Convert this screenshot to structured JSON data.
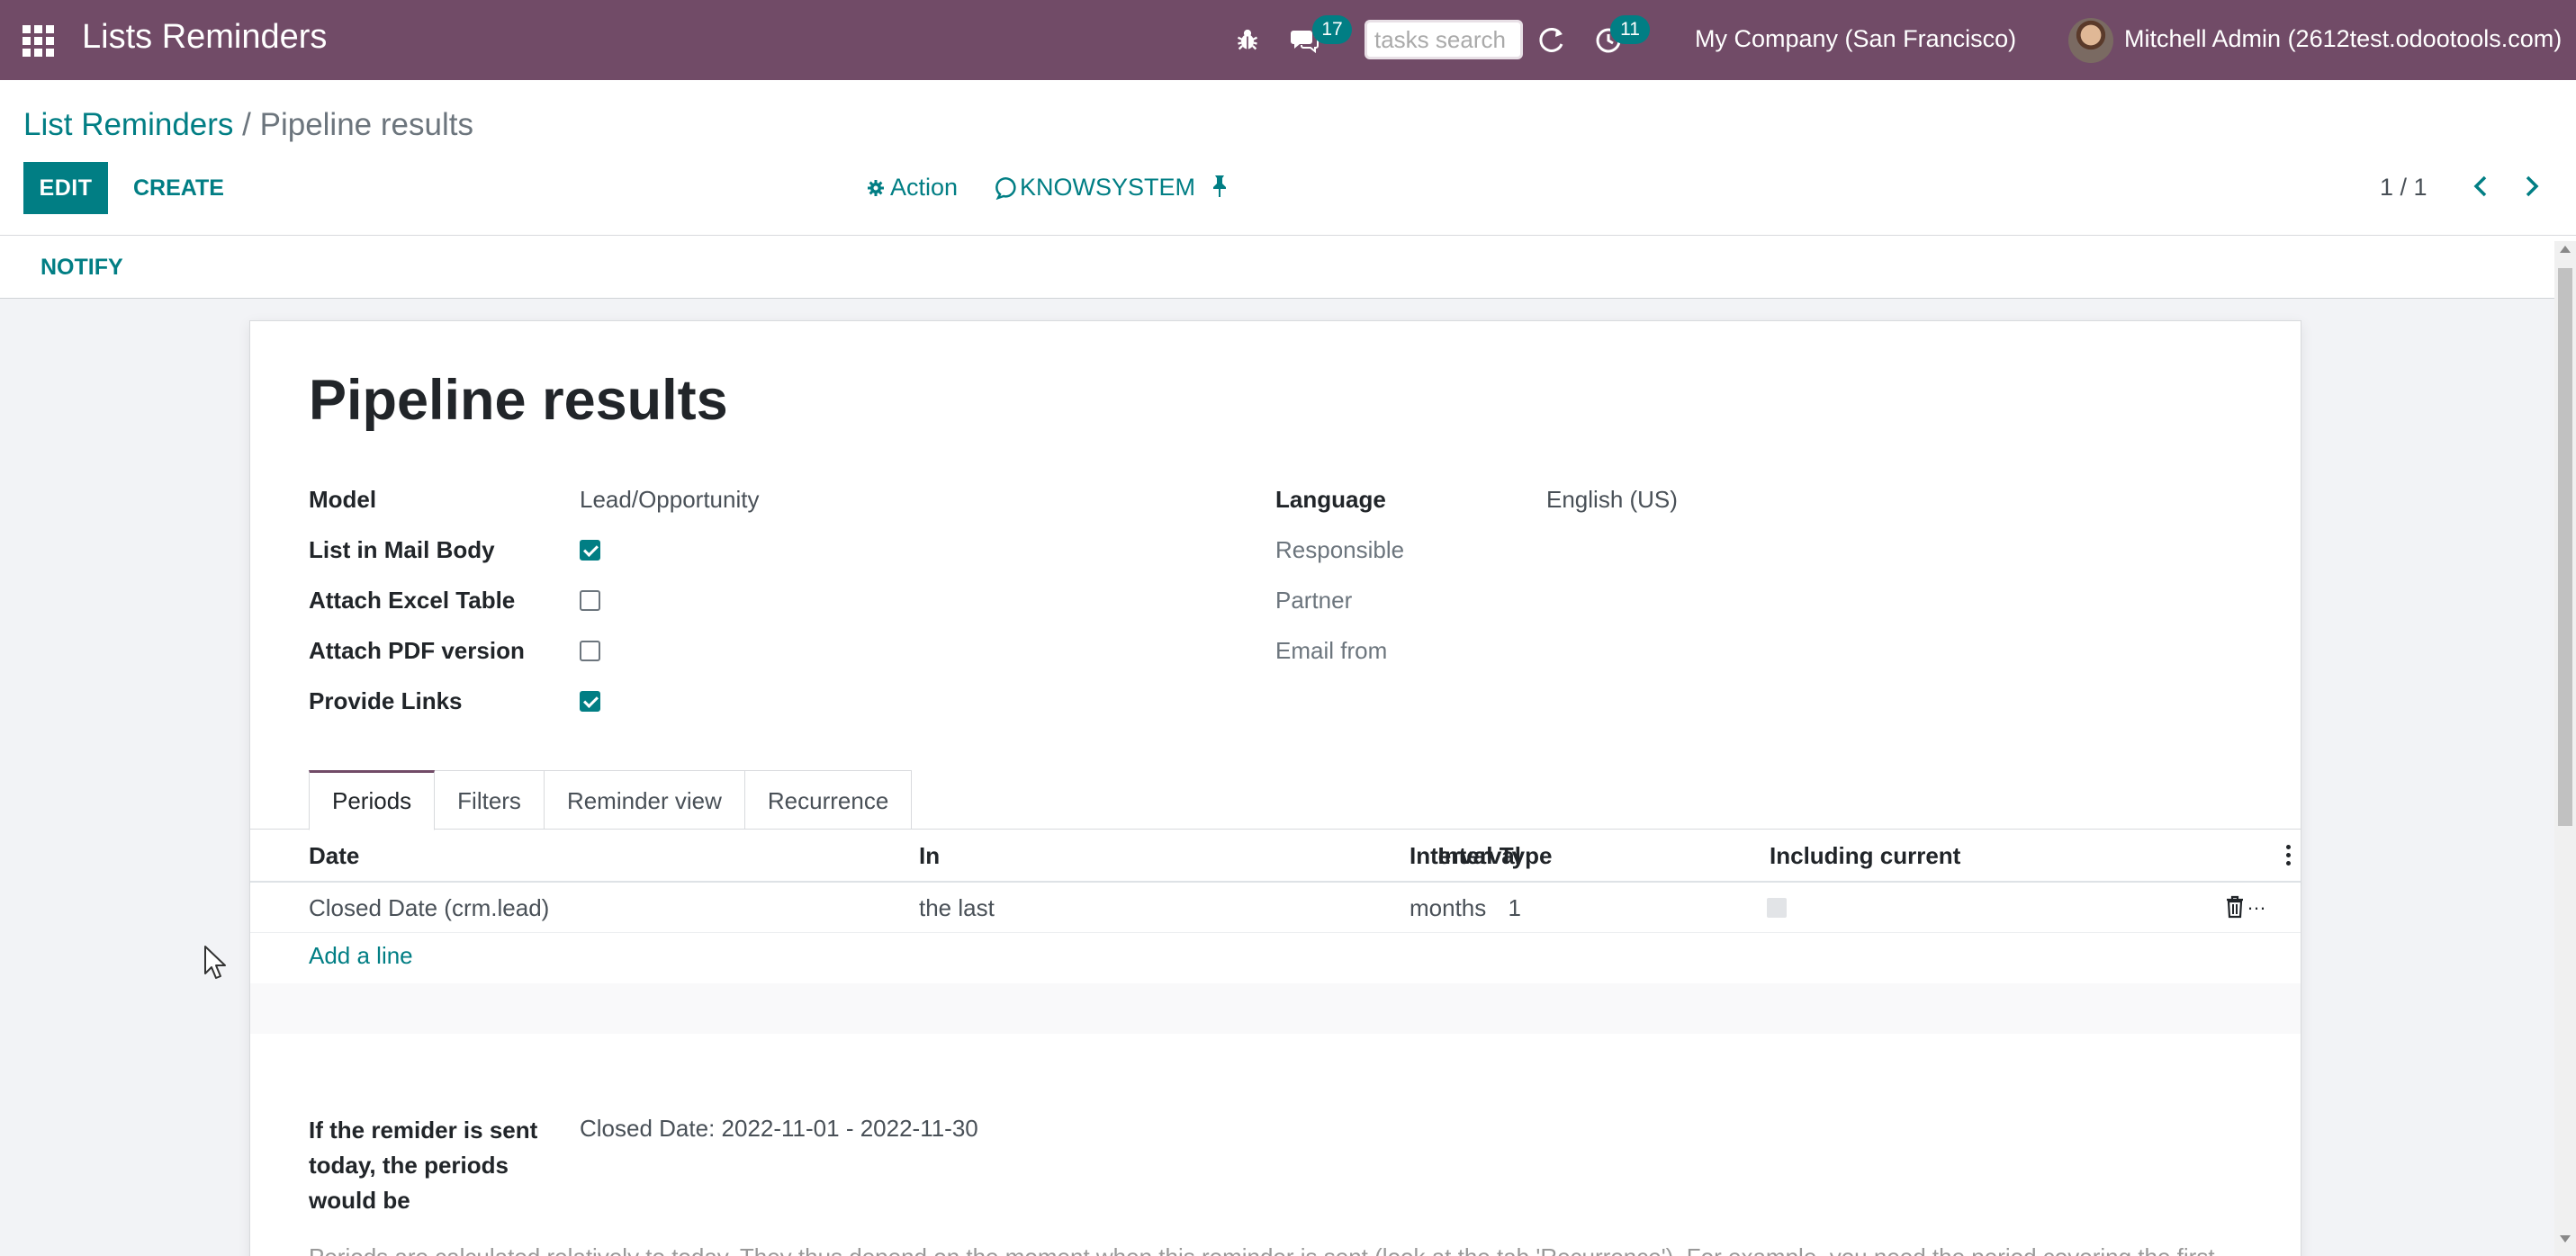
{
  "navbar": {
    "app_title": "Lists Reminders",
    "messages_badge": "17",
    "activities_badge": "11",
    "search_placeholder": "tasks search",
    "company": "My Company (San Francisco)",
    "user": "Mitchell Admin (2612test.odootools.com)"
  },
  "control_panel": {
    "breadcrumb_parent": "List Reminders",
    "breadcrumb_sep": " / ",
    "breadcrumb_current": "Pipeline results",
    "edit_label": "EDIT",
    "create_label": "CREATE",
    "action_label": "Action",
    "knowsystem_label": "KNOWSYSTEM",
    "pager": "1 / 1"
  },
  "statusbar": {
    "notify_label": "NOTIFY"
  },
  "form": {
    "title": "Pipeline results",
    "left_fields": [
      {
        "label": "Model",
        "value": "Lead/Opportunity"
      },
      {
        "label": "List in Mail Body",
        "checked": true
      },
      {
        "label": "Attach Excel Table",
        "checked": false
      },
      {
        "label": "Attach PDF version",
        "checked": false
      },
      {
        "label": "Provide Links",
        "checked": true
      }
    ],
    "right_fields": [
      {
        "label": "Language",
        "value": "English (US)"
      },
      {
        "label": "Responsible",
        "value": ""
      },
      {
        "label": "Partner",
        "value": ""
      },
      {
        "label": "Email from",
        "value": ""
      }
    ],
    "tabs": [
      "Periods",
      "Filters",
      "Reminder view",
      "Recurrence"
    ],
    "active_tab": "Periods",
    "table": {
      "columns": [
        "Date",
        "In",
        "Interval",
        "Interval Type",
        "Including current"
      ],
      "rows": [
        {
          "date": "Closed Date (crm.lead)",
          "in": "the last",
          "interval": "1",
          "interval_type": "months",
          "including_current": false
        }
      ],
      "add_line": "Add a line"
    },
    "periods_label": "If the remider is sent today, the periods would be",
    "periods_value": "Closed Date: 2022-11-01 - 2022-11-30",
    "cut_off_text": "Periods are calculated relatively to today. They thus depend on the moment when this reminder is sent (look at the tab 'Recurrence'). For example, you need the period covering the first"
  },
  "colors": {
    "navbar": "#714b67",
    "accent": "#017e84",
    "background": "#f2f3f6"
  },
  "icons": [
    "apps-icon",
    "bug-icon",
    "chat-icon",
    "refresh-icon",
    "activity-clock-icon",
    "gear-icon",
    "knowsystem-icon",
    "pin-icon",
    "chevron-left-icon",
    "chevron-right-icon",
    "kebab-icon",
    "trash-icon",
    "cursor-icon"
  ]
}
